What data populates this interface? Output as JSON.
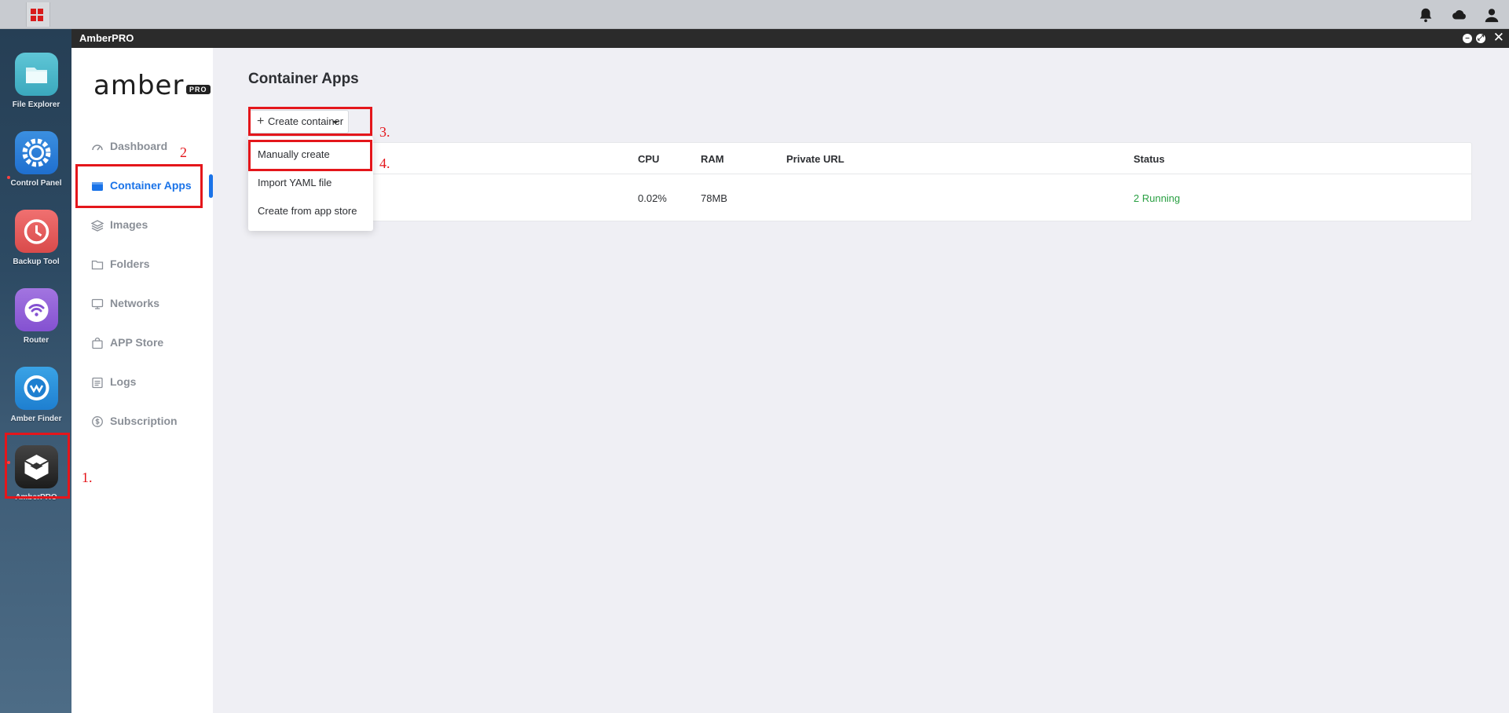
{
  "topbar": {
    "icons": [
      "apps-grid-icon",
      "bell-icon",
      "cloud-icon",
      "user-icon"
    ]
  },
  "dock": {
    "items": [
      {
        "label": "File Explorer",
        "icon": "folder-icon"
      },
      {
        "label": "Control Panel",
        "icon": "gear-icon"
      },
      {
        "label": "Backup Tool",
        "icon": "clock-icon"
      },
      {
        "label": "Router",
        "icon": "wifi-icon"
      },
      {
        "label": "Amber Finder",
        "icon": "finder-icon"
      },
      {
        "label": "AmberPRO",
        "icon": "cube-icon"
      }
    ]
  },
  "window": {
    "title": "AmberPRO"
  },
  "sidebar": {
    "logo_text": "amber",
    "logo_badge": "PRO",
    "items": [
      {
        "label": "Dashboard",
        "icon": "dashboard-icon"
      },
      {
        "label": "Container Apps",
        "icon": "container-icon"
      },
      {
        "label": "Images",
        "icon": "layers-icon"
      },
      {
        "label": "Folders",
        "icon": "folder-icon"
      },
      {
        "label": "Networks",
        "icon": "monitor-icon"
      },
      {
        "label": "APP Store",
        "icon": "bag-icon"
      },
      {
        "label": "Logs",
        "icon": "calendar-icon"
      },
      {
        "label": "Subscription",
        "icon": "dollar-icon"
      }
    ]
  },
  "main": {
    "title": "Container Apps",
    "create_button": "Create container",
    "dropdown": [
      "Manually create",
      "Import YAML file",
      "Create from app store"
    ],
    "table": {
      "headers": [
        "CPU",
        "RAM",
        "Private URL",
        "Status"
      ],
      "rows": [
        {
          "cpu": "0.02%",
          "ram": "78MB",
          "url": "",
          "status": "2 Running"
        }
      ]
    }
  },
  "annotations": [
    "1.",
    "2",
    "3.",
    "4."
  ],
  "colors": {
    "accent": "#1a73e8",
    "status_running": "#2aa043",
    "annotation": "#e4161b"
  }
}
